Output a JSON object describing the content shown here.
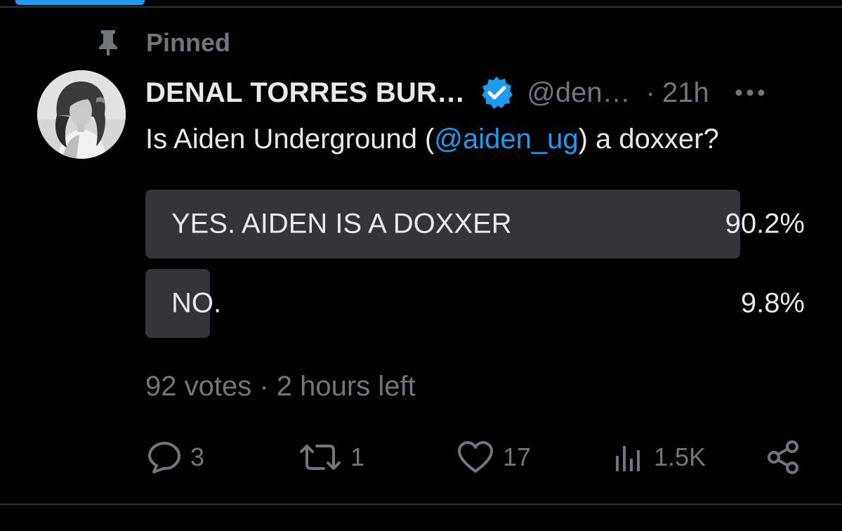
{
  "pinned": {
    "label": "Pinned"
  },
  "author": {
    "name": "DENAL TORRES BUR…",
    "handle": "@den…",
    "separator": "·",
    "time": "21h"
  },
  "post": {
    "text_before": "Is Aiden Underground (",
    "mention": "@aiden_ug",
    "text_after": ") a doxxer?"
  },
  "poll": {
    "options": [
      {
        "label": "YES. AIDEN IS A DOXXER",
        "percent_label": "90.2%",
        "percent": 90.2
      },
      {
        "label": "NO.",
        "percent_label": "9.8%",
        "percent": 9.8
      }
    ],
    "votes": "92 votes",
    "separator": "·",
    "time_left": "2 hours left"
  },
  "actions": {
    "reply_count": "3",
    "repost_count": "1",
    "like_count": "17",
    "views_count": "1.5K"
  },
  "colors": {
    "background": "#000000",
    "accent": "#1d9bf0",
    "muted_text": "#71767b",
    "primary_text": "#e7e9ea",
    "poll_bar": "#333639",
    "divider": "#2f3336"
  },
  "icons": {
    "pin": "pin-icon",
    "verified": "verified-badge-icon",
    "more": "more-dots-icon",
    "reply": "reply-bubble-icon",
    "repost": "repost-icon",
    "like": "heart-icon",
    "views": "views-bar-chart-icon",
    "share": "share-icon"
  }
}
